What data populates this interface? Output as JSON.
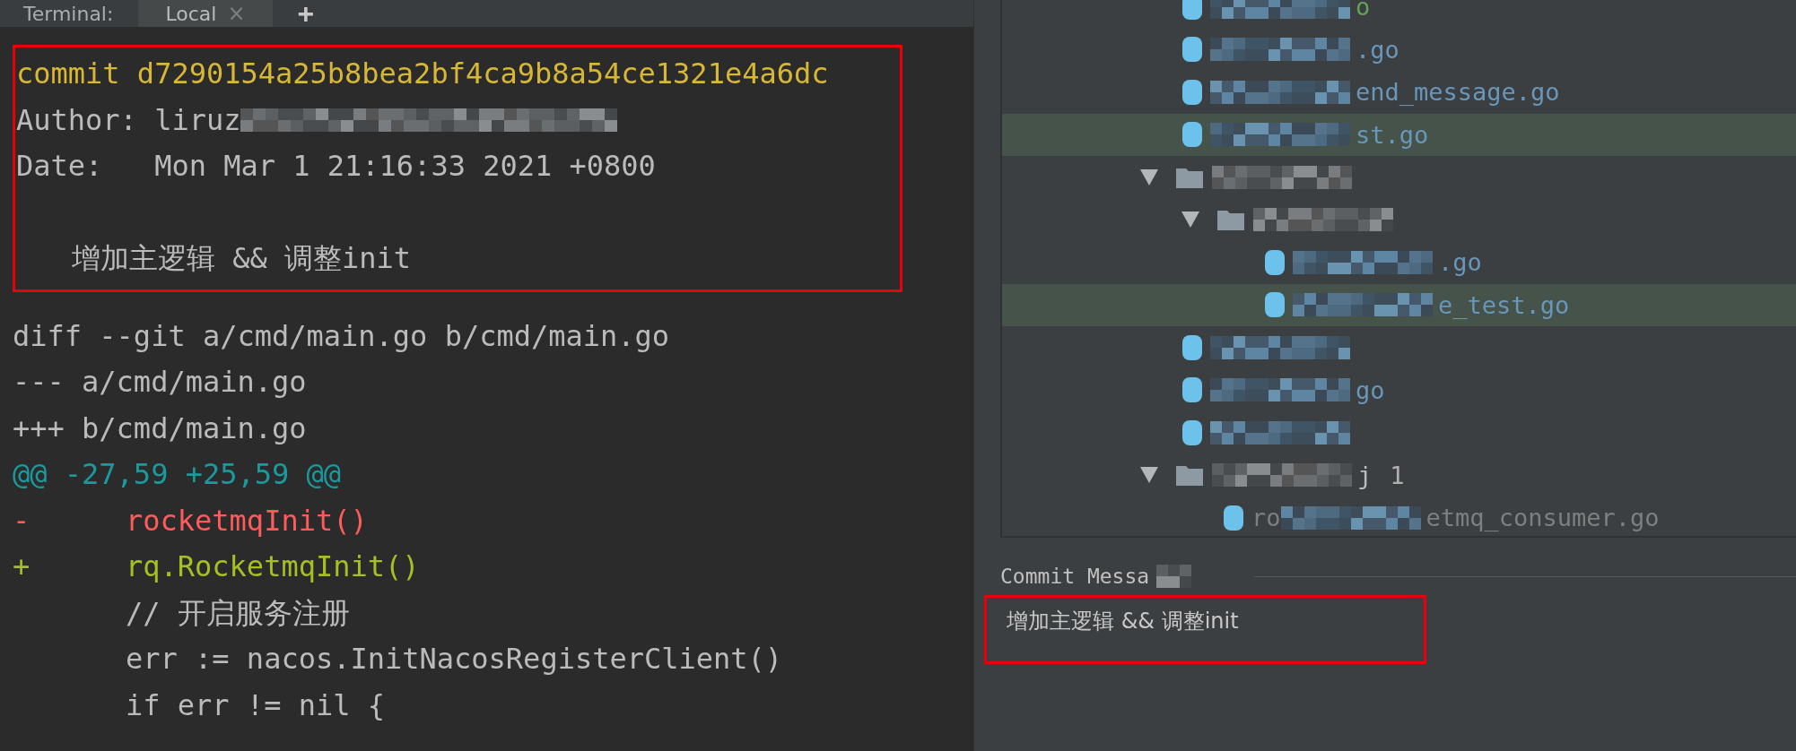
{
  "terminal": {
    "label": "Terminal:",
    "tabs": [
      {
        "label": "Local",
        "close": "×",
        "selected": true
      }
    ],
    "new_tab": "+",
    "commit_box": {
      "highlighted": true,
      "lines": [
        {
          "kind": "commit",
          "text": "commit d7290154a25b8bea2bf4ca9b8a54ce1321e4a6dc"
        },
        {
          "kind": "plain",
          "text": "Author: liruz",
          "redacted": true
        },
        {
          "kind": "plain",
          "text": "Date:   Mon Mar 1 21:16:33 2021 +0800"
        },
        {
          "kind": "blank"
        },
        {
          "kind": "message",
          "text": "增加主逻辑 && 调整init"
        }
      ]
    },
    "diff_lines": [
      {
        "kind": "header",
        "text": "diff --git a/cmd/main.go b/cmd/main.go"
      },
      {
        "kind": "header",
        "text": "--- a/cmd/main.go"
      },
      {
        "kind": "header",
        "text": "+++ b/cmd/main.go"
      },
      {
        "kind": "hunk",
        "text": "@@ -27,59 +25,59 @@"
      },
      {
        "kind": "del",
        "marker": "-",
        "text": "rocketmqInit()"
      },
      {
        "kind": "add",
        "marker": "+",
        "text": "rq.RocketmqInit()"
      },
      {
        "kind": "context",
        "text": "// 开启服务注册"
      },
      {
        "kind": "context",
        "text": "err := nacos.InitNacosRegisterClient()"
      },
      {
        "kind": "context",
        "text": "if err != nil {"
      }
    ]
  },
  "changes_tree": [
    {
      "kind": "file",
      "color": "#62a556",
      "label": "o",
      "redacted": true,
      "selected": false
    },
    {
      "kind": "file",
      "color": "#6897bb",
      "label": ".go",
      "redacted": true,
      "selected": false
    },
    {
      "kind": "file",
      "color": "#6897bb",
      "label": "end_message.go",
      "redacted": true,
      "selected": false
    },
    {
      "kind": "file",
      "color": "#6897bb",
      "label": "st.go",
      "redacted": true,
      "selected": true
    },
    {
      "kind": "folder",
      "expanded": true,
      "redacted": true,
      "children": [
        {
          "kind": "folder",
          "expanded": true,
          "redacted": true,
          "children": [
            {
              "kind": "file",
              "color": "#6897bb",
              "label": ".go",
              "redacted": true,
              "selected": false
            },
            {
              "kind": "file",
              "color": "#6897bb",
              "label": "e_test.go",
              "redacted": true,
              "selected": true
            }
          ]
        }
      ]
    },
    {
      "kind": "file",
      "redacted": true,
      "selected": false
    },
    {
      "kind": "file",
      "color": "#6897bb",
      "label": "go",
      "redacted": true,
      "selected": false
    },
    {
      "kind": "file",
      "redacted": true,
      "selected": false
    },
    {
      "kind": "folder",
      "expanded": true,
      "label": "j",
      "count": "1",
      "redacted": true,
      "children": [
        {
          "kind": "file",
          "color": "#7d7f80",
          "prefix": "ro",
          "label": "etmq_consumer.go",
          "redacted": true,
          "selected": false
        }
      ]
    }
  ],
  "commit_message": {
    "label": "Commit Messa",
    "value": "增加主逻辑 && 调整init",
    "highlighted": true
  }
}
